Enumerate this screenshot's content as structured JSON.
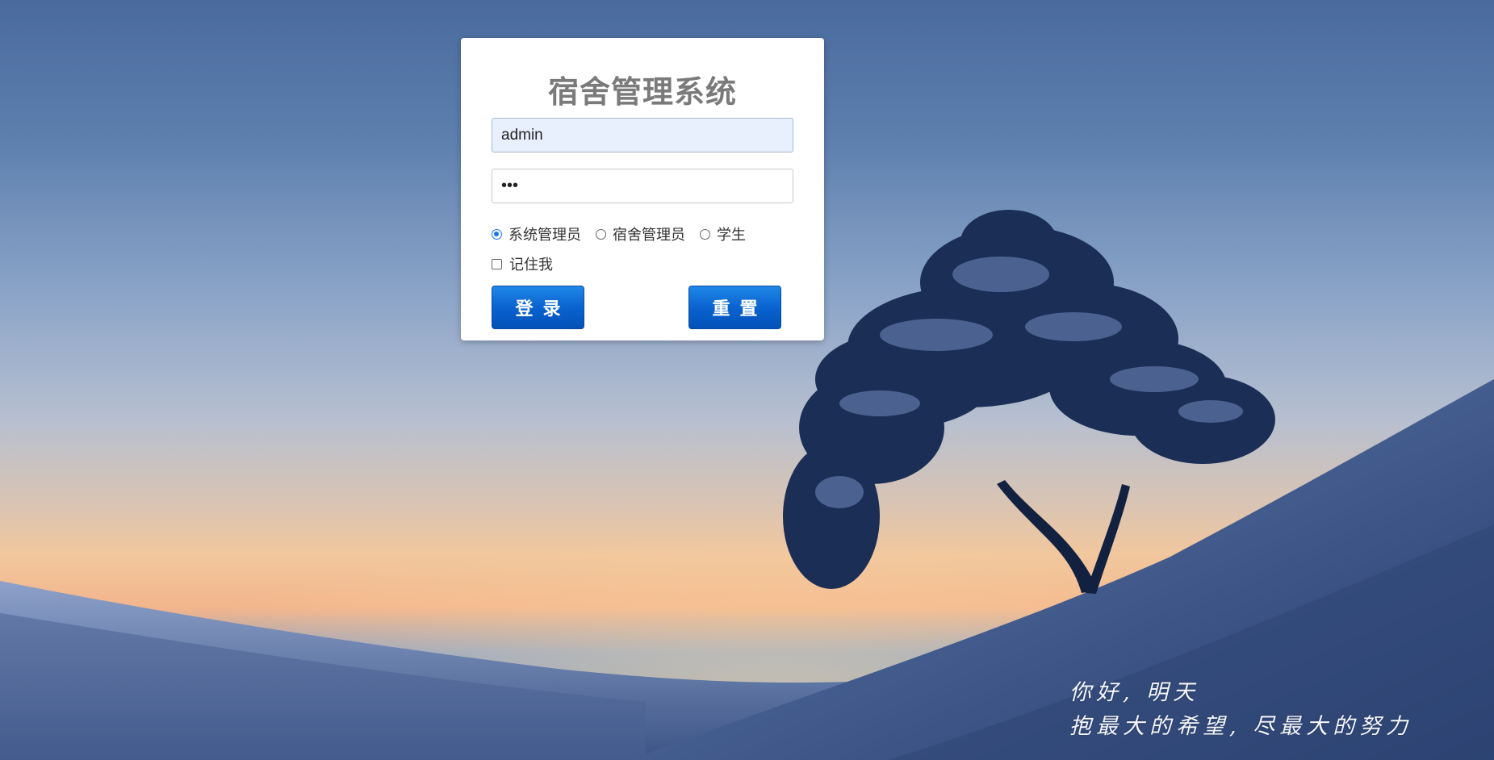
{
  "app": {
    "title": "宿舍管理系统"
  },
  "login": {
    "username_value": "admin",
    "password_value": "•••",
    "roles": [
      {
        "label": "系统管理员",
        "checked": true
      },
      {
        "label": "宿舍管理员",
        "checked": false
      },
      {
        "label": "学生",
        "checked": false
      }
    ],
    "remember_label": "记住我",
    "login_label": "登录",
    "reset_label": "重置"
  },
  "slogan": {
    "line1": "你好, 明天",
    "line2": "抱最大的希望, 尽最大的努力"
  },
  "colors": {
    "button": "#0a63d0",
    "radio_accent": "#1a73e8",
    "title": "#7a7a7a",
    "username_bg": "#e8f0fe"
  }
}
